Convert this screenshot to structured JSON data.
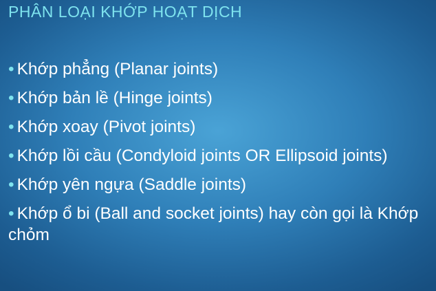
{
  "slide": {
    "title": "PHÂN LOẠI KHỚP HOẠT DỊCH",
    "bullet_marker": "•",
    "bullets": [
      "Khớp phẳng (Planar joints)",
      "Khớp bản lề (Hinge joints)",
      "Khớp xoay (Pivot joints)",
      "Khớp lồi cầu (Condyloid joints OR Ellipsoid joints)",
      "Khớp yên ngựa (Saddle joints)",
      "Khớp ổ bi (Ball and socket joints) hay còn gọi là Khớp chỏm"
    ]
  },
  "colors": {
    "title": "#7ee3ee",
    "bullet_marker": "#7ee3ee",
    "text": "#ffffff",
    "background_center": "#4aa3d6",
    "background_edge": "#174f80"
  }
}
